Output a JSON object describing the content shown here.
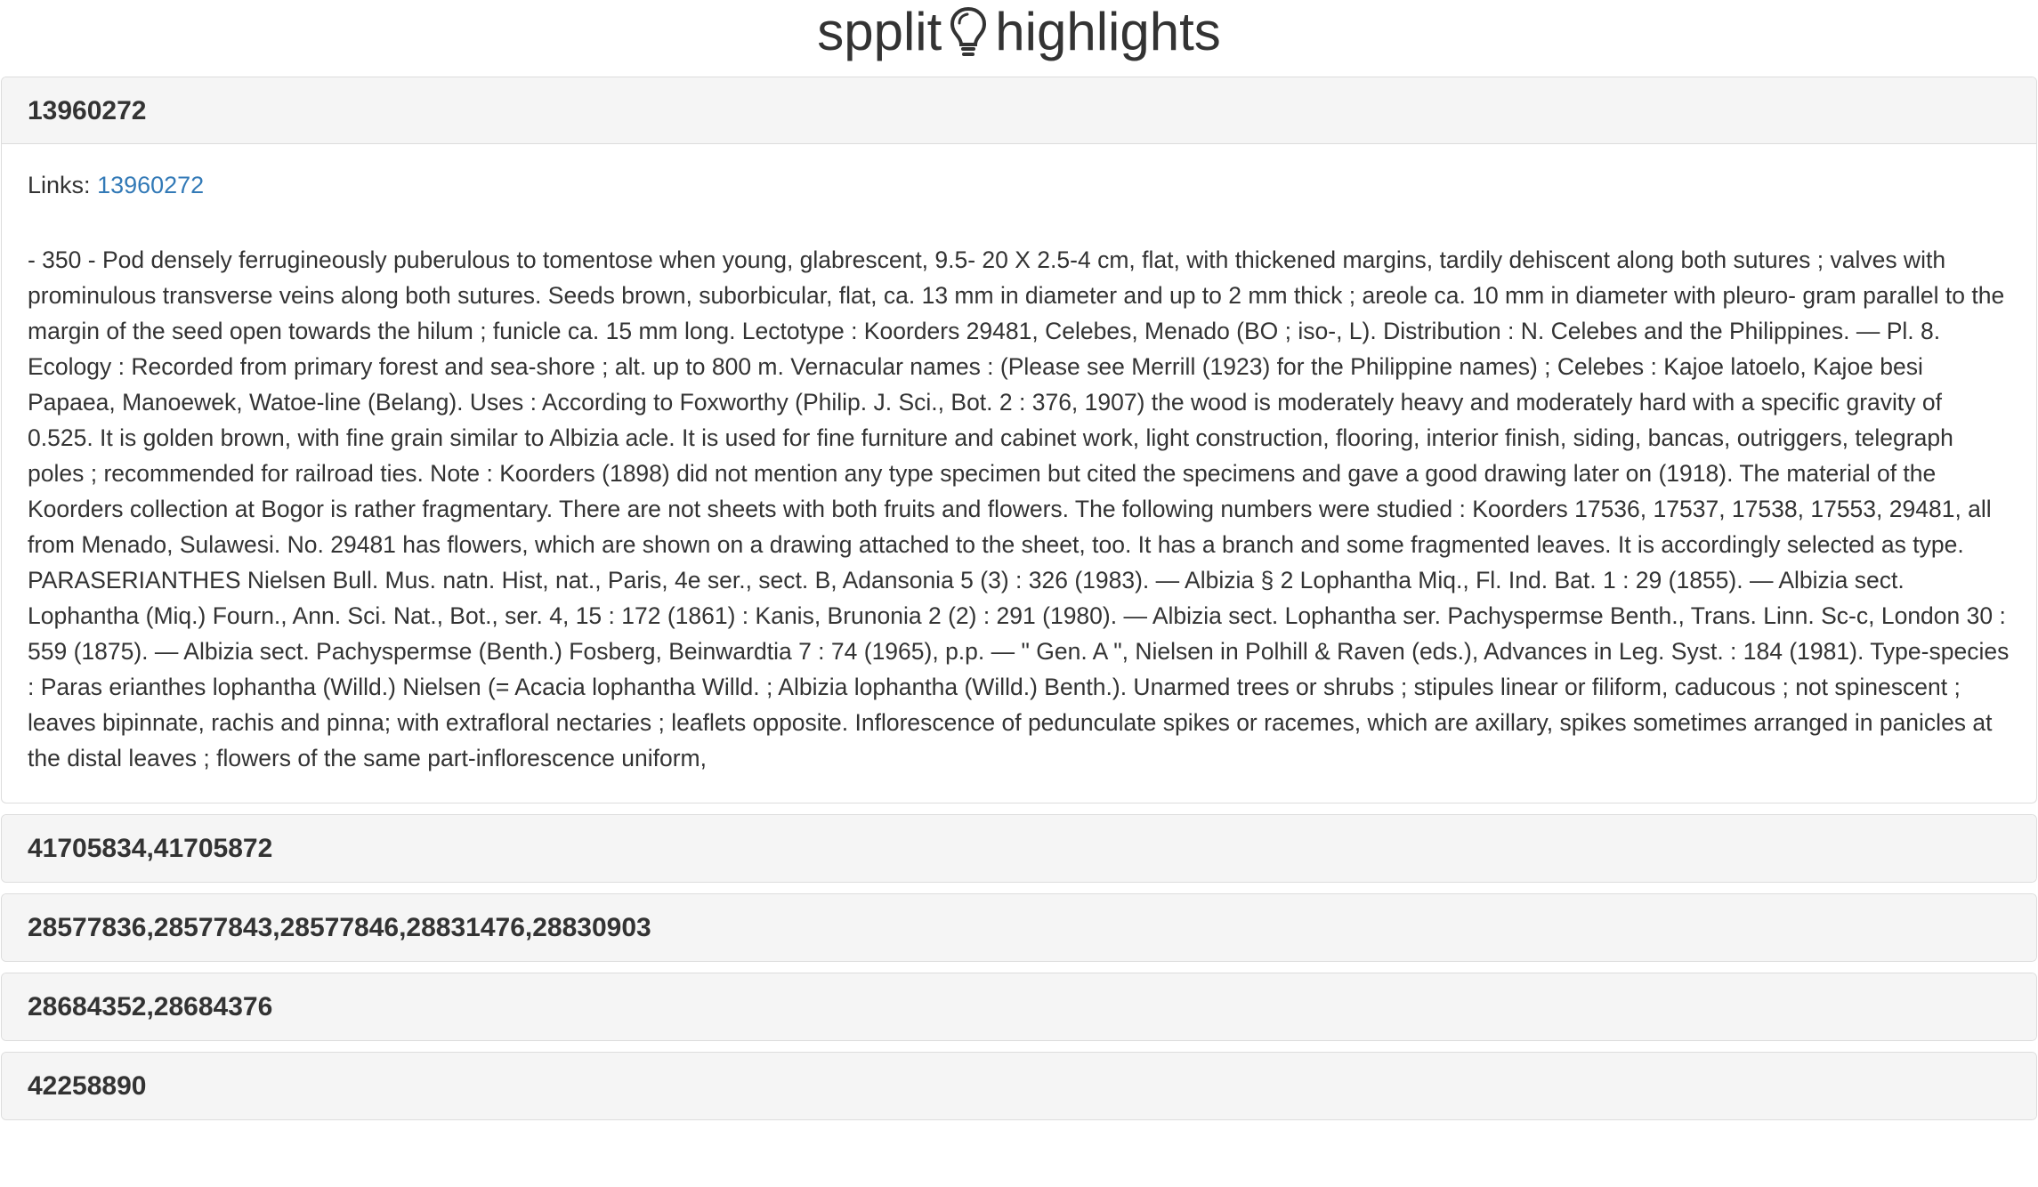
{
  "header": {
    "title_left": "spplit",
    "title_right": "highlights",
    "icon": "lightbulb-icon"
  },
  "panels": [
    {
      "heading": "13960272",
      "expanded": true,
      "links_label": "Links:",
      "link_text": "13960272",
      "passage": "- 350 - Pod densely ferrugineously puberulous to tomentose when young, glabrescent, 9.5- 20 X 2.5-4 cm, flat, with thickened margins, tardily dehiscent along both sutures ; valves with prominulous transverse veins along both sutures. Seeds brown, suborbicular, flat, ca. 13 mm in diameter and up to 2 mm thick ; areole ca. 10 mm in diameter with pleuro- gram parallel to the margin of the seed open towards the hilum ; funicle ca. 15 mm long. Lectotype : Koorders 29481, Celebes, Menado (BO ; iso-, L). Distribution : N. Celebes and the Philippines. — Pl. 8. Ecology : Recorded from primary forest and sea-shore ; alt. up to 800 m. Vernacular names : (Please see Merrill (1923) for the Philippine names) ; Celebes : Kajoe latoelo, Kajoe besi Papaea, Manoewek, Watoe-line (Belang). Uses : According to Foxworthy (Philip. J. Sci., Bot. 2 : 376, 1907) the wood is moderately heavy and moderately hard with a specific gravity of 0.525. It is golden brown, with fine grain similar to Albizia acle. It is used for fine furniture and cabinet work, light construction, flooring, interior finish, siding, bancas, outriggers, telegraph poles ; recommended for railroad ties. Note : Koorders (1898) did not mention any type specimen but cited the specimens and gave a good drawing later on (1918). The material of the Koorders collection at Bogor is rather fragmentary. There are not sheets with both fruits and flowers. The following numbers were studied : Koorders 17536, 17537, 17538, 17553, 29481, all from Menado, Sulawesi. No. 29481 has flowers, which are shown on a drawing attached to the sheet, too. It has a branch and some fragmented leaves. It is accordingly selected as type. PARASERIANTHES Nielsen Bull. Mus. natn. Hist, nat., Paris, 4e ser., sect. B, Adansonia 5 (3) : 326 (1983). — Albizia § 2 Lophantha Miq., Fl. Ind. Bat. 1 : 29 (1855). — Albizia sect. Lophantha (Miq.) Fourn., Ann. Sci. Nat., Bot., ser. 4, 15 : 172 (1861) : Kanis, Brunonia 2 (2) : 291 (1980). — Albizia sect. Lophantha ser. Pachyspermse Benth., Trans. Linn. Sc-c, London 30 : 559 (1875). — Albizia sect. Pachyspermse (Benth.) Fosberg, Beinwardtia 7 : 74 (1965), p.p. — \" Gen. A \", Nielsen in Polhill & Raven (eds.), Advances in Leg. Syst. : 184 (1981). Type-species : Paras erianthes lophantha (Willd.) Nielsen (= Acacia lophantha Willd. ; Albizia lophantha (Willd.) Benth.). Unarmed trees or shrubs ; stipules linear or filiform, caducous ; not spinescent ; leaves bipinnate, rachis and pinna; with extrafloral nectaries ; leaflets opposite. Inflorescence of pedunculate spikes or racemes, which are axillary, spikes sometimes arranged in panicles at the distal leaves ; flowers of the same part-inflorescence uniform,"
    },
    {
      "heading": "41705834,41705872",
      "expanded": false
    },
    {
      "heading": "28577836,28577843,28577846,28831476,28830903",
      "expanded": false
    },
    {
      "heading": "28684352,28684376",
      "expanded": false
    },
    {
      "heading": "42258890",
      "expanded": false
    }
  ]
}
